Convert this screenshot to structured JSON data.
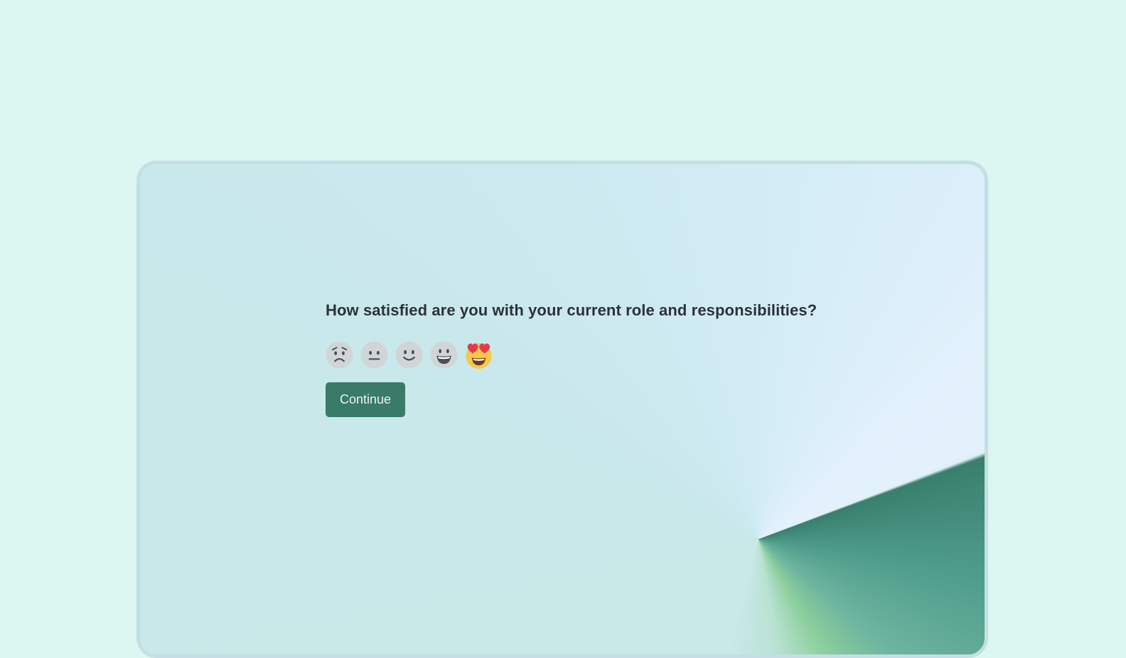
{
  "survey": {
    "question": "How satisfied are you with your current role and responsibilities?",
    "options": [
      {
        "icon": "worried-face-icon",
        "state": "unselected"
      },
      {
        "icon": "neutral-face-icon",
        "state": "unselected"
      },
      {
        "icon": "slightly-smiling-face-icon",
        "state": "unselected"
      },
      {
        "icon": "grinning-face-icon",
        "state": "unselected"
      },
      {
        "icon": "heart-eyes-face-icon",
        "state": "selected"
      }
    ],
    "continue_label": "Continue"
  },
  "colors": {
    "page_background": "#dcf6f2",
    "frame": "#c3dfe3",
    "button": "#3a7a68",
    "button_text": "#eaf6f2",
    "question_text": "#2a3338",
    "unselected_face": "#d1d5d8",
    "unselected_feature": "#4a4f55",
    "selected_face": "#f6c84c",
    "selected_heart": "#e8394a",
    "selected_mouth": "#6b3b1c",
    "accent_dark_green": "#3a7f6d",
    "accent_light_green": "#8ecf9e"
  }
}
